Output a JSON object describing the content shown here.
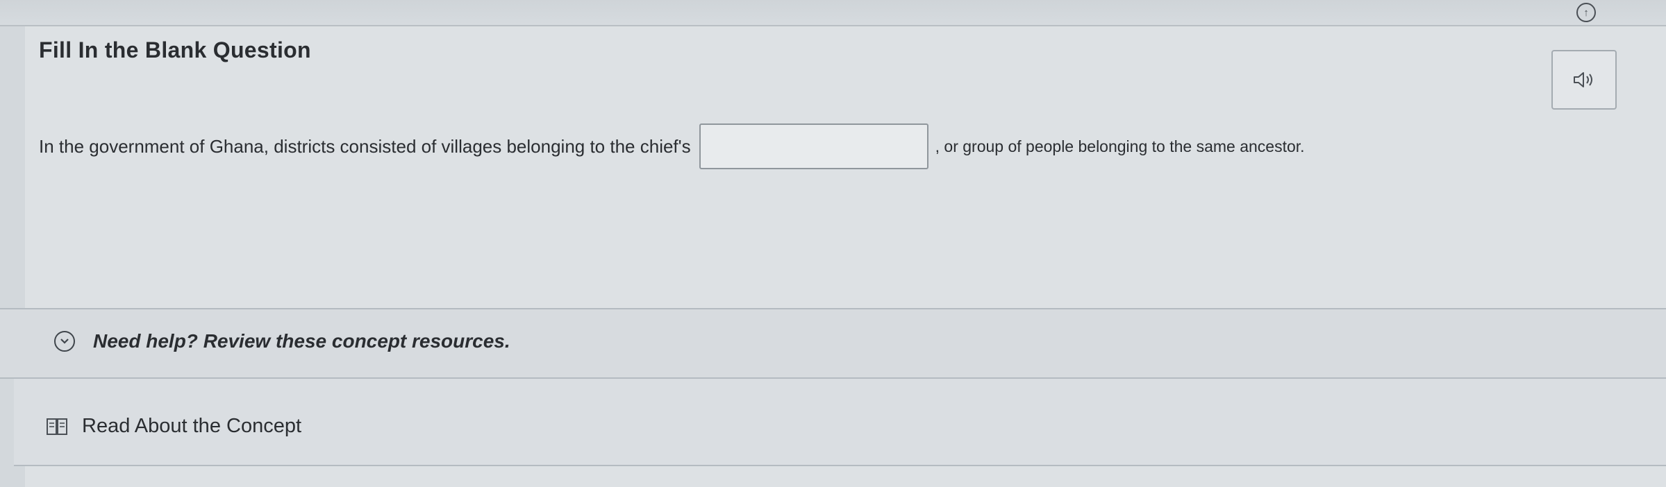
{
  "question": {
    "heading": "Fill In the Blank Question",
    "text_before": "In the government of Ghana, districts consisted of villages belonging to the chief's",
    "blank_value": "",
    "text_after": ", or group of people belonging to the same ancestor."
  },
  "help": {
    "toggle_label": "Need help? Review these concept resources."
  },
  "resources": {
    "link_label": "Read About the Concept"
  },
  "icons": {
    "corner": "circle-arrow-icon",
    "audio": "speaker-icon",
    "help": "chevron-down-circle-icon",
    "resource": "book-icon"
  }
}
